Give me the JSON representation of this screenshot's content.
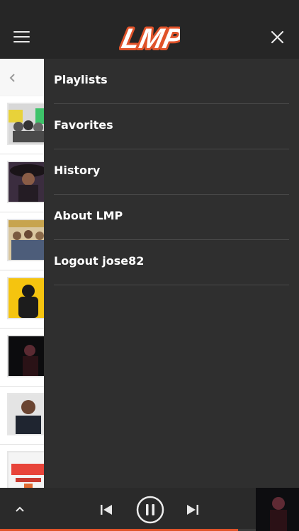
{
  "header": {
    "logo_text": "LMP"
  },
  "icons": {
    "menu": "hamburger-menu-icon",
    "close": "close-icon",
    "back": "chevron-left-icon",
    "expand": "chevron-up-icon",
    "previous": "skip-previous-icon",
    "pause": "pause-icon",
    "next": "skip-next-icon"
  },
  "menu": {
    "items": [
      {
        "label": "Playlists"
      },
      {
        "label": "Favorites"
      },
      {
        "label": "History"
      },
      {
        "label": "About LMP"
      },
      {
        "label": "Logout jose82"
      }
    ]
  },
  "colors": {
    "accent": "#e0532a",
    "drawer_bg": "#2f2f2f",
    "header_bg": "#262626"
  },
  "player": {
    "progress_fraction": 0.93
  }
}
